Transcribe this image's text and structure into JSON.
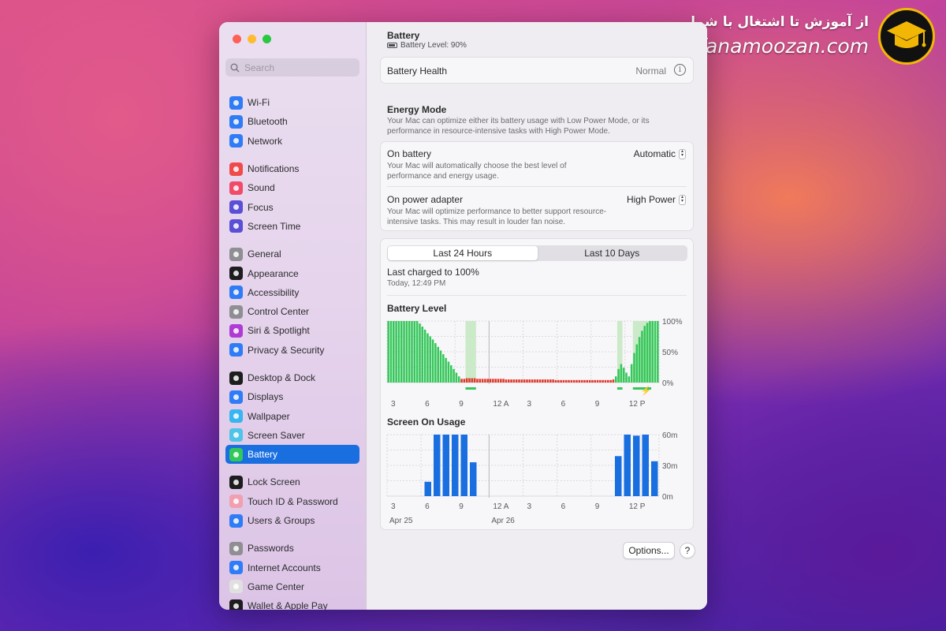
{
  "watermark": {
    "persian": "از آموزش تا اشتغال با شماییم",
    "site": "fanamoozan.com"
  },
  "search": {
    "placeholder": "Search"
  },
  "sidebar": {
    "groups": [
      [
        {
          "label": "Wi-Fi",
          "icon": "wifi-icon",
          "color": "#2f7cf6"
        },
        {
          "label": "Bluetooth",
          "icon": "bluetooth-icon",
          "color": "#2f7cf6"
        },
        {
          "label": "Network",
          "icon": "globe-icon",
          "color": "#2f7cf6"
        }
      ],
      [
        {
          "label": "Notifications",
          "icon": "bell-icon",
          "color": "#f04b4b"
        },
        {
          "label": "Sound",
          "icon": "speaker-icon",
          "color": "#f04b6b"
        },
        {
          "label": "Focus",
          "icon": "moon-icon",
          "color": "#5b4fd6"
        },
        {
          "label": "Screen Time",
          "icon": "hourglass-icon",
          "color": "#5b4fd6"
        }
      ],
      [
        {
          "label": "General",
          "icon": "gear-icon",
          "color": "#8e8e93"
        },
        {
          "label": "Appearance",
          "icon": "appearance-icon",
          "color": "#1d1d1f"
        },
        {
          "label": "Accessibility",
          "icon": "accessibility-icon",
          "color": "#2f7cf6"
        },
        {
          "label": "Control Center",
          "icon": "toggles-icon",
          "color": "#8e8e93"
        },
        {
          "label": "Siri & Spotlight",
          "icon": "siri-icon",
          "color": "#b03ad6"
        },
        {
          "label": "Privacy & Security",
          "icon": "hand-icon",
          "color": "#2f7cf6"
        }
      ],
      [
        {
          "label": "Desktop & Dock",
          "icon": "dock-icon",
          "color": "#1d1d1f"
        },
        {
          "label": "Displays",
          "icon": "sun-icon",
          "color": "#2f7cf6"
        },
        {
          "label": "Wallpaper",
          "icon": "flower-icon",
          "color": "#38b6f0"
        },
        {
          "label": "Screen Saver",
          "icon": "screensaver-icon",
          "color": "#4fc3e8"
        },
        {
          "label": "Battery",
          "icon": "battery-icon",
          "color": "#34c759",
          "active": true
        }
      ],
      [
        {
          "label": "Lock Screen",
          "icon": "lock-icon",
          "color": "#1d1d1f"
        },
        {
          "label": "Touch ID & Password",
          "icon": "fingerprint-icon",
          "color": "#f0a0b0"
        },
        {
          "label": "Users & Groups",
          "icon": "users-icon",
          "color": "#2f7cf6"
        }
      ],
      [
        {
          "label": "Passwords",
          "icon": "key-icon",
          "color": "#8e8e93"
        },
        {
          "label": "Internet Accounts",
          "icon": "at-icon",
          "color": "#2f7cf6"
        },
        {
          "label": "Game Center",
          "icon": "gamecenter-icon",
          "color": "#e0e0e0"
        },
        {
          "label": "Wallet & Apple Pay",
          "icon": "wallet-icon",
          "color": "#1d1d1f"
        }
      ]
    ]
  },
  "header": {
    "title": "Battery",
    "level_text": "Battery Level: 90%"
  },
  "health": {
    "label": "Battery Health",
    "value": "Normal"
  },
  "energy": {
    "title": "Energy Mode",
    "desc": "Your Mac can optimize either its battery usage with Low Power Mode, or its performance in resource-intensive tasks with High Power Mode.",
    "on_battery": {
      "label": "On battery",
      "desc": "Your Mac will automatically choose the best level of performance and energy usage.",
      "value": "Automatic"
    },
    "on_adapter": {
      "label": "On power adapter",
      "desc": "Your Mac will optimize performance to better support resource-intensive tasks. This may result in louder fan noise.",
      "value": "High Power"
    }
  },
  "usage": {
    "tabs": [
      "Last 24 Hours",
      "Last 10 Days"
    ],
    "last_charged": "Last charged to 100%",
    "last_charged_time": "Today, 12:49 PM"
  },
  "footer": {
    "options": "Options...",
    "help": "?"
  },
  "colors": {
    "accent": "#1a6fe0",
    "battery_green": "#34c759",
    "battery_red": "#e0392b",
    "usage_blue": "#1a6fe0",
    "charging_band": "#b8e6b4"
  },
  "chart_data": [
    {
      "type": "bar",
      "title": "Battery Level",
      "x_tick_labels": [
        "3",
        "6",
        "9",
        "12 A",
        "3",
        "6",
        "9",
        "12 P"
      ],
      "y_tick_labels": [
        "100%",
        "50%",
        "0%"
      ],
      "ylim": [
        0,
        100
      ],
      "values": [
        100,
        100,
        100,
        100,
        100,
        100,
        100,
        100,
        100,
        100,
        100,
        100,
        96,
        91,
        86,
        80,
        75,
        70,
        64,
        58,
        52,
        46,
        40,
        34,
        28,
        22,
        16,
        10,
        6,
        6,
        7,
        7,
        7,
        7,
        6,
        6,
        6,
        6,
        6,
        6,
        6,
        6,
        6,
        6,
        6,
        5,
        5,
        5,
        5,
        5,
        5,
        5,
        5,
        5,
        5,
        5,
        5,
        5,
        5,
        5,
        5,
        5,
        5,
        5,
        4,
        4,
        4,
        4,
        4,
        4,
        4,
        4,
        4,
        4,
        4,
        4,
        4,
        4,
        4,
        4,
        4,
        4,
        4,
        4,
        4,
        4,
        5,
        10,
        22,
        30,
        24,
        16,
        10,
        30,
        48,
        62,
        74,
        84,
        92,
        97,
        100,
        100,
        100,
        100
      ],
      "low_threshold": 8,
      "charging_ranges": [
        [
          30,
          34
        ],
        [
          88,
          90
        ],
        [
          94,
          101
        ]
      ],
      "grid": true
    },
    {
      "type": "bar",
      "title": "Screen On Usage",
      "x_tick_labels": [
        "3",
        "6",
        "9",
        "12 A",
        "3",
        "6",
        "9",
        "12 P"
      ],
      "date_labels": [
        "Apr 25",
        "Apr 26"
      ],
      "y_tick_labels": [
        "60m",
        "30m",
        "0m"
      ],
      "ylim": [
        0,
        60
      ],
      "values": [
        0,
        0,
        0,
        0,
        14,
        60,
        60,
        60,
        60,
        33,
        0,
        0,
        0,
        0,
        0,
        0,
        0,
        0,
        0,
        0,
        0,
        0,
        0,
        0,
        0,
        39,
        60,
        59,
        60,
        34
      ],
      "grid": true
    }
  ]
}
